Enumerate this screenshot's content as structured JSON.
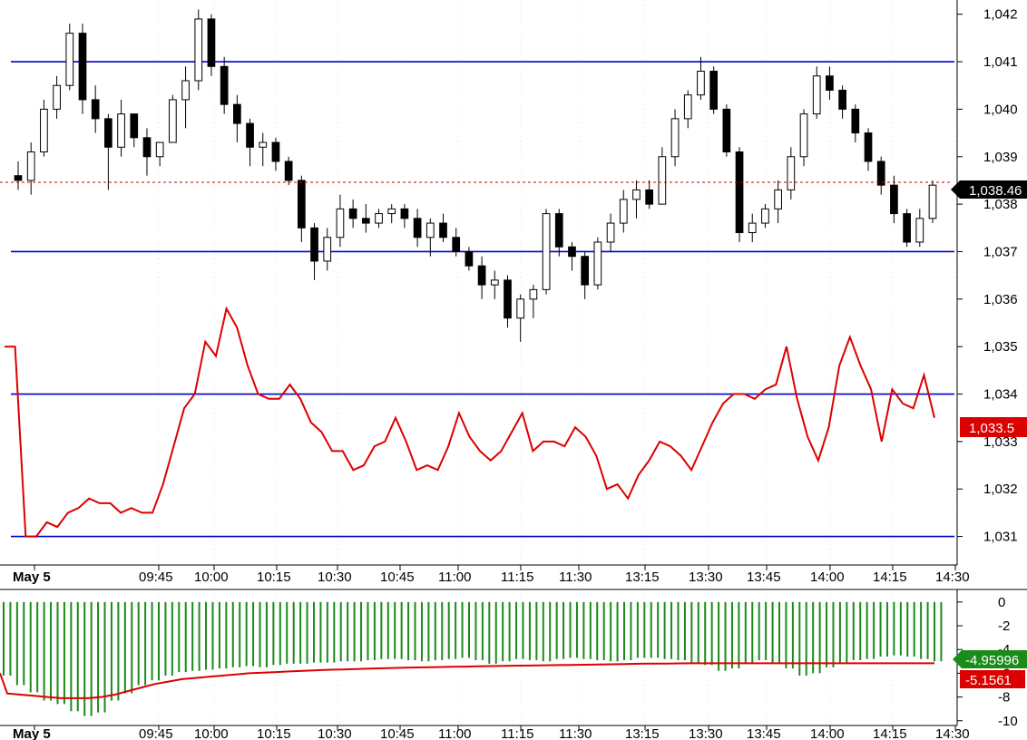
{
  "colors": {
    "background": "#ffffff",
    "axis": "#000000",
    "grid": "#c8c8c8",
    "candle": "#000000",
    "level_line": "#0000cc",
    "red_line": "#dd0000",
    "last_price_line": "#cc0000",
    "hist": "#1a8c1a",
    "hist_badge": "#1a8c1a",
    "red_badge": "#dd0000",
    "price_badge": "#000000"
  },
  "chart_data": [
    {
      "type": "candlestick",
      "name": "price-panel",
      "ylim": [
        1030.4,
        1042.3
      ],
      "yticks": [
        1042,
        1041,
        1040,
        1039,
        1038,
        1037,
        1036,
        1035,
        1034,
        1033,
        1032,
        1031
      ],
      "ytick_labels": [
        "1,042",
        "1,041",
        "1,040",
        "1,039",
        "1,038",
        "1,037",
        "1,036",
        "1,035",
        "1,034",
        "1,033",
        "1,032",
        "1,031"
      ],
      "x_labels": [
        "May 5",
        "09:45",
        "10:00",
        "10:15",
        "10:30",
        "10:45",
        "11:00",
        "11:15",
        "11:30",
        "13:15",
        "13:30",
        "13:45",
        "14:00",
        "14:15",
        "14:30"
      ],
      "horizontal_levels": [
        1041,
        1037,
        1034,
        1031
      ],
      "last_price": 1038.46,
      "last_price_label": "1,038.46",
      "red_line_last_label": "1,033.5",
      "red_line": [
        1035,
        1035,
        1031,
        1031,
        1031.3,
        1031.2,
        1031.5,
        1031.6,
        1031.8,
        1031.7,
        1031.7,
        1031.5,
        1031.6,
        1031.5,
        1031.5,
        1032.1,
        1032.9,
        1033.7,
        1034,
        1035.1,
        1034.8,
        1035.8,
        1035.4,
        1034.6,
        1034,
        1033.9,
        1033.9,
        1034.2,
        1033.9,
        1033.4,
        1033.2,
        1032.8,
        1032.8,
        1032.4,
        1032.5,
        1032.9,
        1033,
        1033.5,
        1033,
        1032.4,
        1032.5,
        1032.4,
        1032.9,
        1033.6,
        1033.1,
        1032.8,
        1032.6,
        1032.8,
        1033.2,
        1033.6,
        1032.8,
        1033,
        1033,
        1032.9,
        1033.3,
        1033.1,
        1032.7,
        1032,
        1032.1,
        1031.8,
        1032.3,
        1032.6,
        1033,
        1032.9,
        1032.7,
        1032.4,
        1032.9,
        1033.4,
        1033.8,
        1034,
        1034,
        1033.9,
        1034.1,
        1034.2,
        1035,
        1033.9,
        1033.1,
        1032.6,
        1033.3,
        1034.6,
        1035.2,
        1034.6,
        1034.1,
        1033,
        1034.1,
        1033.8,
        1033.7,
        1034.4,
        1033.5
      ],
      "candles": [
        [
          1038.6,
          1038.9,
          1038.3,
          1038.5
        ],
        [
          1038.5,
          1039.3,
          1038.2,
          1039.1
        ],
        [
          1039.1,
          1040.2,
          1039,
          1040
        ],
        [
          1040,
          1040.7,
          1039.8,
          1040.5
        ],
        [
          1040.5,
          1041.8,
          1040.4,
          1041.6
        ],
        [
          1041.6,
          1041.8,
          1039.9,
          1040.2
        ],
        [
          1040.2,
          1040.5,
          1039.5,
          1039.8
        ],
        [
          1039.8,
          1039.9,
          1038.3,
          1039.2
        ],
        [
          1039.2,
          1040.2,
          1039,
          1039.9
        ],
        [
          1039.9,
          1039.9,
          1039.2,
          1039.4
        ],
        [
          1039.4,
          1039.6,
          1038.6,
          1039.0
        ],
        [
          1039.0,
          1039.3,
          1038.8,
          1039.3
        ],
        [
          1039.3,
          1040.3,
          1039.3,
          1040.2
        ],
        [
          1040.2,
          1040.9,
          1039.6,
          1040.6
        ],
        [
          1040.6,
          1042.1,
          1040.4,
          1041.9
        ],
        [
          1041.9,
          1042,
          1040.7,
          1040.9
        ],
        [
          1040.9,
          1041.1,
          1039.9,
          1040.1
        ],
        [
          1040.1,
          1040.3,
          1039.3,
          1039.7
        ],
        [
          1039.7,
          1039.8,
          1038.8,
          1039.2
        ],
        [
          1039.2,
          1039.5,
          1038.8,
          1039.3
        ],
        [
          1039.3,
          1039.4,
          1038.7,
          1038.9
        ],
        [
          1038.9,
          1039,
          1038.4,
          1038.5
        ],
        [
          1038.5,
          1038.6,
          1037.2,
          1037.5
        ],
        [
          1037.5,
          1037.6,
          1036.4,
          1036.8
        ],
        [
          1036.8,
          1037.5,
          1036.6,
          1037.3
        ],
        [
          1037.3,
          1038.2,
          1037.1,
          1037.9
        ],
        [
          1037.9,
          1038.1,
          1037.5,
          1037.7
        ],
        [
          1037.7,
          1038,
          1037.4,
          1037.6
        ],
        [
          1037.6,
          1037.9,
          1037.5,
          1037.8
        ],
        [
          1037.8,
          1038,
          1037.6,
          1037.9
        ],
        [
          1037.9,
          1038,
          1037.5,
          1037.7
        ],
        [
          1037.7,
          1037.9,
          1037.1,
          1037.3
        ],
        [
          1037.3,
          1037.7,
          1036.9,
          1037.6
        ],
        [
          1037.6,
          1037.8,
          1037.2,
          1037.3
        ],
        [
          1037.3,
          1037.5,
          1036.9,
          1037.0
        ],
        [
          1037.0,
          1037.1,
          1036.6,
          1036.7
        ],
        [
          1036.7,
          1036.9,
          1036.0,
          1036.3
        ],
        [
          1036.3,
          1036.6,
          1036.0,
          1036.4
        ],
        [
          1036.4,
          1036.5,
          1035.4,
          1035.6
        ],
        [
          1035.6,
          1036.1,
          1035.1,
          1036.0
        ],
        [
          1036.0,
          1036.3,
          1035.6,
          1036.2
        ],
        [
          1036.2,
          1037.9,
          1036.1,
          1037.8
        ],
        [
          1037.8,
          1037.9,
          1036.9,
          1037.1
        ],
        [
          1037.1,
          1037.2,
          1036.6,
          1036.9
        ],
        [
          1036.9,
          1037,
          1036.0,
          1036.3
        ],
        [
          1036.3,
          1037.3,
          1036.2,
          1037.2
        ],
        [
          1037.2,
          1037.8,
          1037,
          1037.6
        ],
        [
          1037.6,
          1038.3,
          1037.4,
          1038.1
        ],
        [
          1038.1,
          1038.5,
          1037.7,
          1038.3
        ],
        [
          1038.3,
          1038.5,
          1037.9,
          1038.0
        ],
        [
          1038.0,
          1039.2,
          1038,
          1039.0
        ],
        [
          1039.0,
          1040,
          1038.8,
          1039.8
        ],
        [
          1039.8,
          1040.4,
          1039.6,
          1040.3
        ],
        [
          1040.3,
          1041.1,
          1040.2,
          1040.8
        ],
        [
          1040.8,
          1040.9,
          1039.9,
          1040.0
        ],
        [
          1040.0,
          1040.1,
          1039.0,
          1039.1
        ],
        [
          1039.1,
          1039.2,
          1037.2,
          1037.4
        ],
        [
          1037.4,
          1037.8,
          1037.2,
          1037.6
        ],
        [
          1037.6,
          1038,
          1037.5,
          1037.9
        ],
        [
          1037.9,
          1038.5,
          1037.6,
          1038.3
        ],
        [
          1038.3,
          1039.2,
          1038.1,
          1039.0
        ],
        [
          1039.0,
          1040,
          1038.8,
          1039.9
        ],
        [
          1039.9,
          1040.9,
          1039.8,
          1040.7
        ],
        [
          1040.7,
          1040.9,
          1040.2,
          1040.4
        ],
        [
          1040.4,
          1040.5,
          1039.8,
          1040.0
        ],
        [
          1040.0,
          1040.1,
          1039.3,
          1039.5
        ],
        [
          1039.5,
          1039.6,
          1038.7,
          1038.9
        ],
        [
          1038.9,
          1039,
          1038.2,
          1038.4
        ],
        [
          1038.4,
          1038.6,
          1037.6,
          1037.8
        ],
        [
          1037.8,
          1037.9,
          1037.1,
          1037.2
        ],
        [
          1037.2,
          1037.9,
          1037.1,
          1037.7
        ],
        [
          1037.7,
          1038.5,
          1037.6,
          1038.4
        ]
      ]
    },
    {
      "type": "bar",
      "name": "indicator-panel",
      "ylim": [
        -10.4,
        0.6
      ],
      "yticks": [
        0,
        -2,
        -4,
        -6,
        -8,
        -10
      ],
      "ytick_labels": [
        "0",
        "-2",
        "-4",
        "-6",
        "-8",
        "-10"
      ],
      "x_labels": [
        "May 5",
        "09:45",
        "10:00",
        "10:15",
        "10:30",
        "10:45",
        "11:00",
        "11:15",
        "11:30",
        "13:15",
        "13:30",
        "13:45",
        "14:00",
        "14:15",
        "14:30"
      ],
      "hist_last_label": "-4.95996",
      "line_last_label": "-5.1561",
      "hist_values": [
        -6.2,
        -7.0,
        -7.6,
        -8.3,
        -8.6,
        -9.2,
        -9.6,
        -9.3,
        -8.3,
        -7.7,
        -7.0,
        -6.6,
        -6.2,
        -5.9,
        -5.8,
        -5.7,
        -5.6,
        -5.5,
        -5.4,
        -5.5,
        -5.3,
        -5.2,
        -5.2,
        -5.1,
        -5.1,
        -5.0,
        -5.0,
        -4.9,
        -4.8,
        -4.8,
        -4.9,
        -5.0,
        -4.9,
        -4.8,
        -4.7,
        -4.9,
        -5.2,
        -5.0,
        -4.8,
        -4.9,
        -5.0,
        -4.8,
        -4.7,
        -4.8,
        -4.9,
        -5.0,
        -4.9,
        -4.7,
        -4.7,
        -4.8,
        -4.9,
        -5.1,
        -5.3,
        -5.8,
        -5.6,
        -5.2,
        -4.9,
        -5.1,
        -5.6,
        -6.2,
        -6.0,
        -5.5,
        -5.2,
        -4.9,
        -4.8,
        -4.6,
        -4.5,
        -4.6,
        -4.8,
        -5.0
      ],
      "line_values": [
        -7.7,
        -7.8,
        -7.9,
        -8.0,
        -8.1,
        -8.1,
        -8.1,
        -8.0,
        -7.8,
        -7.5,
        -7.2,
        -6.9,
        -6.7,
        -6.5,
        -6.4,
        -6.3,
        -6.2,
        -6.1,
        -6.0,
        -5.95,
        -5.9,
        -5.85,
        -5.8,
        -5.75,
        -5.7,
        -5.68,
        -5.65,
        -5.6,
        -5.58,
        -5.55,
        -5.52,
        -5.5,
        -5.48,
        -5.46,
        -5.44,
        -5.42,
        -5.4,
        -5.38,
        -5.36,
        -5.35,
        -5.33,
        -5.31,
        -5.3,
        -5.28,
        -5.26,
        -5.24,
        -5.22,
        -5.2,
        -5.19,
        -5.18,
        -5.17,
        -5.16,
        -5.16,
        -5.16,
        -5.16,
        -5.16,
        -5.16,
        -5.16,
        -5.16,
        -5.16,
        -5.16,
        -5.16,
        -5.16,
        -5.16,
        -5.16,
        -5.16,
        -5.16,
        -5.16,
        -5.16,
        -5.16
      ]
    }
  ]
}
